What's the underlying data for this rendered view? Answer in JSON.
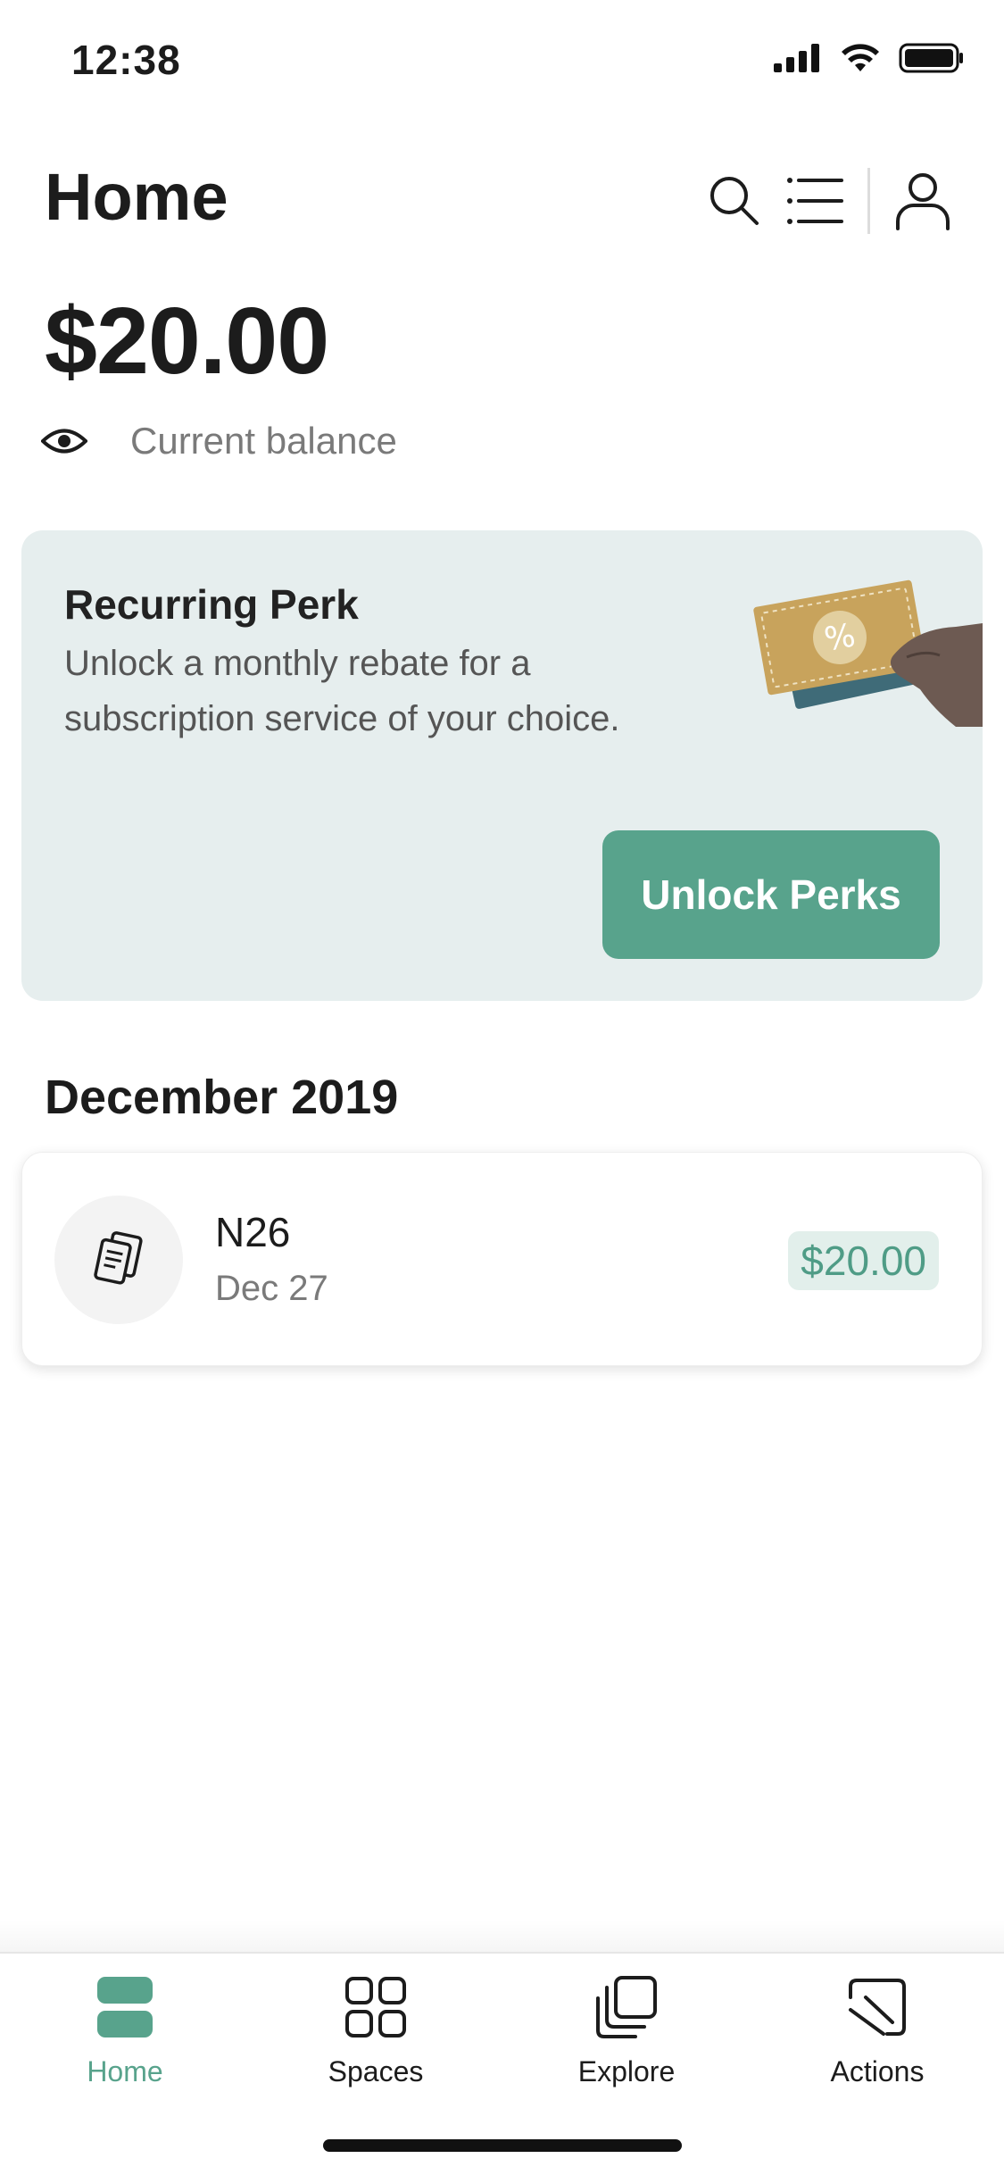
{
  "status_bar": {
    "time": "12:38"
  },
  "header": {
    "title": "Home"
  },
  "balance": {
    "amount": "$20.00",
    "label": "Current balance"
  },
  "perk_card": {
    "title": "Recurring Perk",
    "description": "Unlock a monthly rebate for a subscription service of your choice.",
    "button_label": "Unlock Perks"
  },
  "transactions": {
    "month": "December 2019",
    "items": [
      {
        "name": "N26",
        "date": "Dec 27",
        "amount": "$20.00"
      }
    ]
  },
  "bottom_nav": {
    "items": [
      {
        "label": "Home",
        "active": true
      },
      {
        "label": "Spaces",
        "active": false
      },
      {
        "label": "Explore",
        "active": false
      },
      {
        "label": "Actions",
        "active": false
      }
    ]
  },
  "colors": {
    "accent": "#58a38c",
    "card_background": "#e6eeee",
    "amount_badge": "#e2efeb"
  },
  "icons": [
    "search-icon",
    "list-icon",
    "profile-icon",
    "eye-icon",
    "document-icon",
    "home-icon",
    "spaces-icon",
    "explore-icon",
    "actions-icon"
  ]
}
